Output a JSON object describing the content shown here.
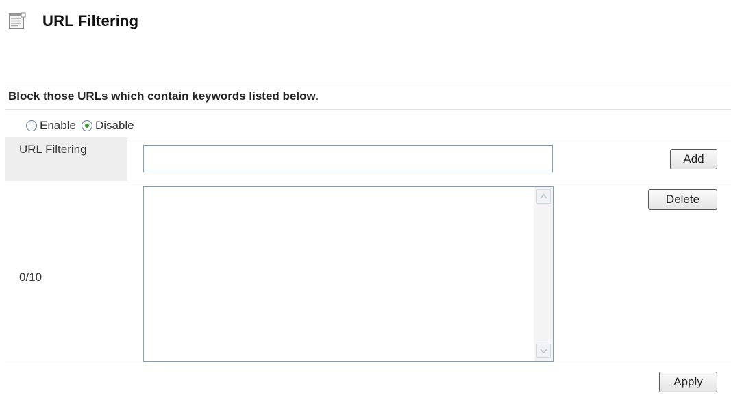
{
  "header": {
    "title": "URL Filtering",
    "icon": "document-icon"
  },
  "section": {
    "description": "Block those URLs which contain keywords listed below."
  },
  "filter_mode": {
    "options": [
      {
        "label": "Enable",
        "selected": false
      },
      {
        "label": "Disable",
        "selected": true
      }
    ]
  },
  "url_filter": {
    "label": "URL Filtering",
    "input_value": "",
    "add_label": "Add"
  },
  "keyword_list": {
    "count": "0/10",
    "items": [],
    "delete_label": "Delete"
  },
  "footer": {
    "apply_label": "Apply"
  },
  "colors": {
    "radio_checked": "#2f9d2a",
    "input_border": "#7f9db9",
    "label_cell_bg": "#eeeeee"
  }
}
